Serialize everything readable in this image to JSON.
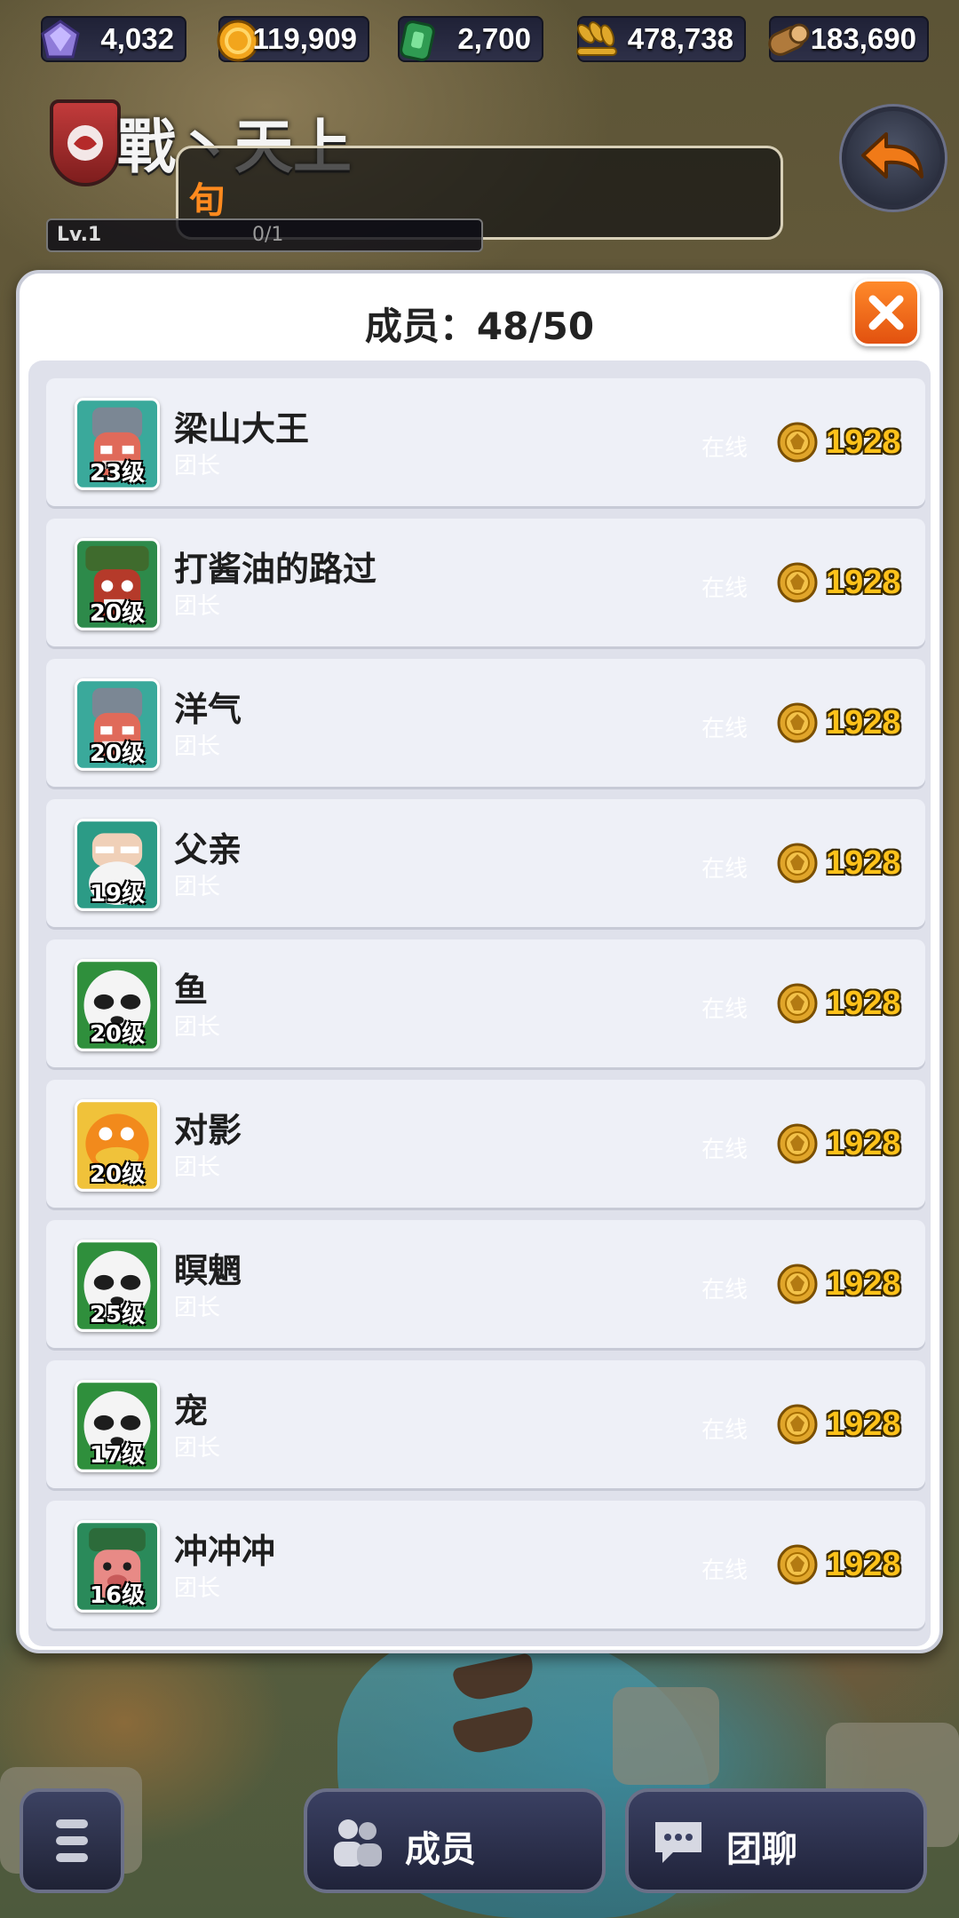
{
  "resources": [
    {
      "icon": "gem-icon",
      "value": "4,032"
    },
    {
      "icon": "gold-coin-icon",
      "value": "119,909"
    },
    {
      "icon": "jade-token-icon",
      "value": "2,700"
    },
    {
      "icon": "wheat-icon",
      "value": "478,738"
    },
    {
      "icon": "wood-log-icon",
      "value": "183,690"
    }
  ],
  "guild": {
    "name": "戰丶天上",
    "notice": "旬",
    "level_label": "Lv.1",
    "level_progress": "0/1"
  },
  "panel": {
    "title": "成员：48/50"
  },
  "members": [
    {
      "name": "梁山大王",
      "role": "团长",
      "status": "在线",
      "points": "1928",
      "level": "23级",
      "avatar": "red-helmet-warrior"
    },
    {
      "name": "打酱油的路过",
      "role": "团长",
      "status": "在线",
      "points": "1928",
      "level": "20级",
      "avatar": "green-hat-warrior"
    },
    {
      "name": "洋气",
      "role": "团长",
      "status": "在线",
      "points": "1928",
      "level": "20级",
      "avatar": "red-helmet-warrior"
    },
    {
      "name": "父亲",
      "role": "团长",
      "status": "在线",
      "points": "1928",
      "level": "19级",
      "avatar": "white-beard-sage"
    },
    {
      "name": "鱼",
      "role": "团长",
      "status": "在线",
      "points": "1928",
      "level": "20级",
      "avatar": "panda"
    },
    {
      "name": "对影",
      "role": "团长",
      "status": "在线",
      "points": "1928",
      "level": "20级",
      "avatar": "orange-duck"
    },
    {
      "name": "瞑魍",
      "role": "团长",
      "status": "在线",
      "points": "1928",
      "level": "25级",
      "avatar": "panda"
    },
    {
      "name": "宠",
      "role": "团长",
      "status": "在线",
      "points": "1928",
      "level": "17级",
      "avatar": "panda"
    },
    {
      "name": "冲冲冲",
      "role": "团长",
      "status": "在线",
      "points": "1928",
      "level": "16级",
      "avatar": "pig-warrior"
    }
  ],
  "bottom_bar": {
    "members_tab": "成员",
    "chat_tab": "团聊"
  }
}
